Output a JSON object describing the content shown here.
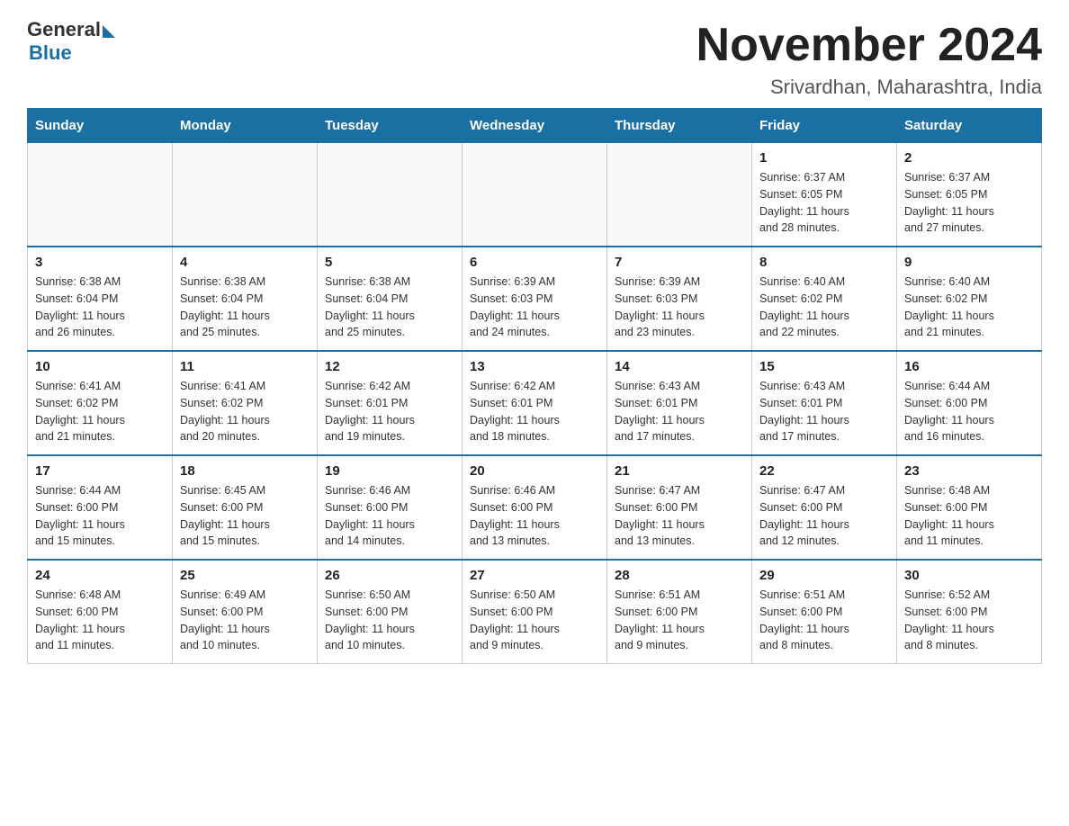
{
  "header": {
    "logo_general": "General",
    "logo_blue": "Blue",
    "month_year": "November 2024",
    "location": "Srivardhan, Maharashtra, India"
  },
  "days_of_week": [
    "Sunday",
    "Monday",
    "Tuesday",
    "Wednesday",
    "Thursday",
    "Friday",
    "Saturday"
  ],
  "weeks": [
    [
      {
        "day": "",
        "info": ""
      },
      {
        "day": "",
        "info": ""
      },
      {
        "day": "",
        "info": ""
      },
      {
        "day": "",
        "info": ""
      },
      {
        "day": "",
        "info": ""
      },
      {
        "day": "1",
        "info": "Sunrise: 6:37 AM\nSunset: 6:05 PM\nDaylight: 11 hours\nand 28 minutes."
      },
      {
        "day": "2",
        "info": "Sunrise: 6:37 AM\nSunset: 6:05 PM\nDaylight: 11 hours\nand 27 minutes."
      }
    ],
    [
      {
        "day": "3",
        "info": "Sunrise: 6:38 AM\nSunset: 6:04 PM\nDaylight: 11 hours\nand 26 minutes."
      },
      {
        "day": "4",
        "info": "Sunrise: 6:38 AM\nSunset: 6:04 PM\nDaylight: 11 hours\nand 25 minutes."
      },
      {
        "day": "5",
        "info": "Sunrise: 6:38 AM\nSunset: 6:04 PM\nDaylight: 11 hours\nand 25 minutes."
      },
      {
        "day": "6",
        "info": "Sunrise: 6:39 AM\nSunset: 6:03 PM\nDaylight: 11 hours\nand 24 minutes."
      },
      {
        "day": "7",
        "info": "Sunrise: 6:39 AM\nSunset: 6:03 PM\nDaylight: 11 hours\nand 23 minutes."
      },
      {
        "day": "8",
        "info": "Sunrise: 6:40 AM\nSunset: 6:02 PM\nDaylight: 11 hours\nand 22 minutes."
      },
      {
        "day": "9",
        "info": "Sunrise: 6:40 AM\nSunset: 6:02 PM\nDaylight: 11 hours\nand 21 minutes."
      }
    ],
    [
      {
        "day": "10",
        "info": "Sunrise: 6:41 AM\nSunset: 6:02 PM\nDaylight: 11 hours\nand 21 minutes."
      },
      {
        "day": "11",
        "info": "Sunrise: 6:41 AM\nSunset: 6:02 PM\nDaylight: 11 hours\nand 20 minutes."
      },
      {
        "day": "12",
        "info": "Sunrise: 6:42 AM\nSunset: 6:01 PM\nDaylight: 11 hours\nand 19 minutes."
      },
      {
        "day": "13",
        "info": "Sunrise: 6:42 AM\nSunset: 6:01 PM\nDaylight: 11 hours\nand 18 minutes."
      },
      {
        "day": "14",
        "info": "Sunrise: 6:43 AM\nSunset: 6:01 PM\nDaylight: 11 hours\nand 17 minutes."
      },
      {
        "day": "15",
        "info": "Sunrise: 6:43 AM\nSunset: 6:01 PM\nDaylight: 11 hours\nand 17 minutes."
      },
      {
        "day": "16",
        "info": "Sunrise: 6:44 AM\nSunset: 6:00 PM\nDaylight: 11 hours\nand 16 minutes."
      }
    ],
    [
      {
        "day": "17",
        "info": "Sunrise: 6:44 AM\nSunset: 6:00 PM\nDaylight: 11 hours\nand 15 minutes."
      },
      {
        "day": "18",
        "info": "Sunrise: 6:45 AM\nSunset: 6:00 PM\nDaylight: 11 hours\nand 15 minutes."
      },
      {
        "day": "19",
        "info": "Sunrise: 6:46 AM\nSunset: 6:00 PM\nDaylight: 11 hours\nand 14 minutes."
      },
      {
        "day": "20",
        "info": "Sunrise: 6:46 AM\nSunset: 6:00 PM\nDaylight: 11 hours\nand 13 minutes."
      },
      {
        "day": "21",
        "info": "Sunrise: 6:47 AM\nSunset: 6:00 PM\nDaylight: 11 hours\nand 13 minutes."
      },
      {
        "day": "22",
        "info": "Sunrise: 6:47 AM\nSunset: 6:00 PM\nDaylight: 11 hours\nand 12 minutes."
      },
      {
        "day": "23",
        "info": "Sunrise: 6:48 AM\nSunset: 6:00 PM\nDaylight: 11 hours\nand 11 minutes."
      }
    ],
    [
      {
        "day": "24",
        "info": "Sunrise: 6:48 AM\nSunset: 6:00 PM\nDaylight: 11 hours\nand 11 minutes."
      },
      {
        "day": "25",
        "info": "Sunrise: 6:49 AM\nSunset: 6:00 PM\nDaylight: 11 hours\nand 10 minutes."
      },
      {
        "day": "26",
        "info": "Sunrise: 6:50 AM\nSunset: 6:00 PM\nDaylight: 11 hours\nand 10 minutes."
      },
      {
        "day": "27",
        "info": "Sunrise: 6:50 AM\nSunset: 6:00 PM\nDaylight: 11 hours\nand 9 minutes."
      },
      {
        "day": "28",
        "info": "Sunrise: 6:51 AM\nSunset: 6:00 PM\nDaylight: 11 hours\nand 9 minutes."
      },
      {
        "day": "29",
        "info": "Sunrise: 6:51 AM\nSunset: 6:00 PM\nDaylight: 11 hours\nand 8 minutes."
      },
      {
        "day": "30",
        "info": "Sunrise: 6:52 AM\nSunset: 6:00 PM\nDaylight: 11 hours\nand 8 minutes."
      }
    ]
  ]
}
